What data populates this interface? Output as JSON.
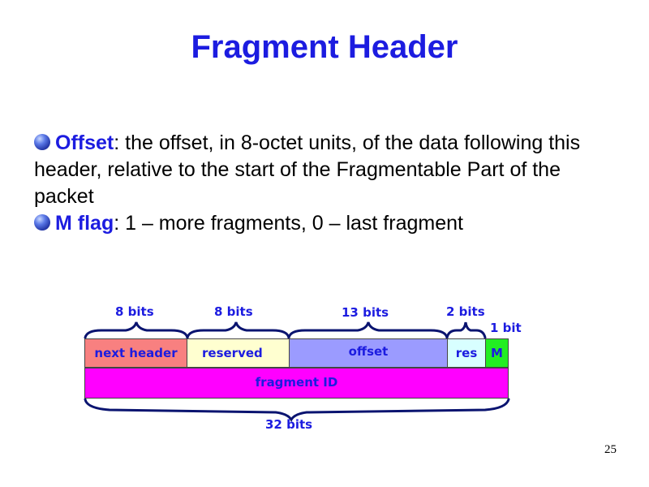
{
  "slide": {
    "title": "Fragment Header",
    "page_number": "25",
    "bullets": [
      {
        "term": "Offset",
        "text": ": the offset, in 8-octet units, of the data following this header, relative to the start of the Fragmentable Part of the packet"
      },
      {
        "term": "M flag",
        "text": ": 1 – more fragments, 0 – last fragment"
      }
    ]
  },
  "diagram": {
    "row1_fields": [
      {
        "label": "next header",
        "bits": "8 bits",
        "color": "#f88080"
      },
      {
        "label": "reserved",
        "bits": "8 bits",
        "color": "#ffffd0"
      },
      {
        "label": "offset",
        "bits": "13 bits",
        "color": "#9b9bff"
      },
      {
        "label": "res",
        "bits": "2 bits",
        "color": "#d8ffff"
      },
      {
        "label": "M",
        "bits": "1 bit",
        "color": "#22ee22"
      }
    ],
    "row2_field": {
      "label": "fragment ID",
      "color": "#ff00ff"
    },
    "total_bits": "32 bits",
    "text_color": "#1c1ce0",
    "brace_color": "#0a1470"
  }
}
